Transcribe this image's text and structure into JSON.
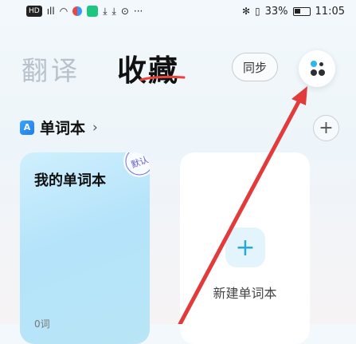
{
  "status_bar": {
    "left_icons": [
      "hd-icon",
      "signal-icon",
      "wifi-icon",
      "app-icon",
      "download-icon",
      "download-icon",
      "settings-icon",
      "more-dots-icon"
    ],
    "bluetooth_vibrate": "✻ 𝄃",
    "battery_text": "33%",
    "time": "11:05"
  },
  "header": {
    "tab_translate": "翻译",
    "tab_favorites": "收藏",
    "sync_label": "同步"
  },
  "section": {
    "title": "单词本",
    "icon_letter": "A",
    "chevron": "›",
    "add_symbol": "+"
  },
  "cards": {
    "my_wordbook": {
      "title": "我的单词本",
      "badge": "默认",
      "count": "0词"
    },
    "new_wordbook": {
      "plus": "+",
      "label": "新建单词本"
    }
  },
  "colors": {
    "accent": "#25a8e0",
    "annotation_arrow": "#e23b3b",
    "underline": "#e8443a"
  }
}
